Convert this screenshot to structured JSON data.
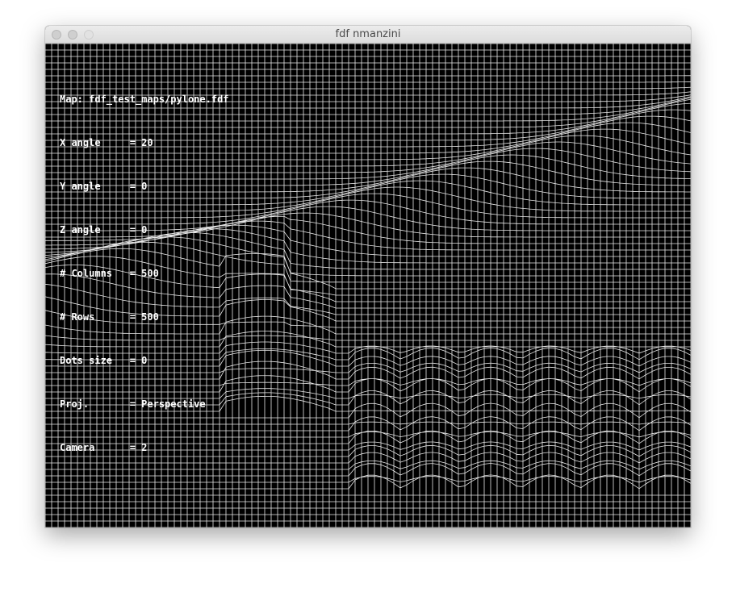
{
  "window": {
    "title": "fdf nmanzini"
  },
  "info_panel": {
    "lines": [
      "Map: fdf_test_maps/pylone.fdf",
      "X angle     = 20",
      "Y angle     = 0",
      "Z angle     = 0",
      "# Columns   = 500",
      "# Rows      = 500",
      "Dots size   = 0",
      "Proj.       = Perspective",
      "Camera      = 2"
    ]
  },
  "colors": {
    "background": "#000000",
    "wire": "#ffffff",
    "titlebar": "#e4e4e4"
  },
  "icons": {
    "close": "traffic-light-close",
    "minimize": "traffic-light-minimize",
    "zoom": "traffic-light-zoom"
  }
}
